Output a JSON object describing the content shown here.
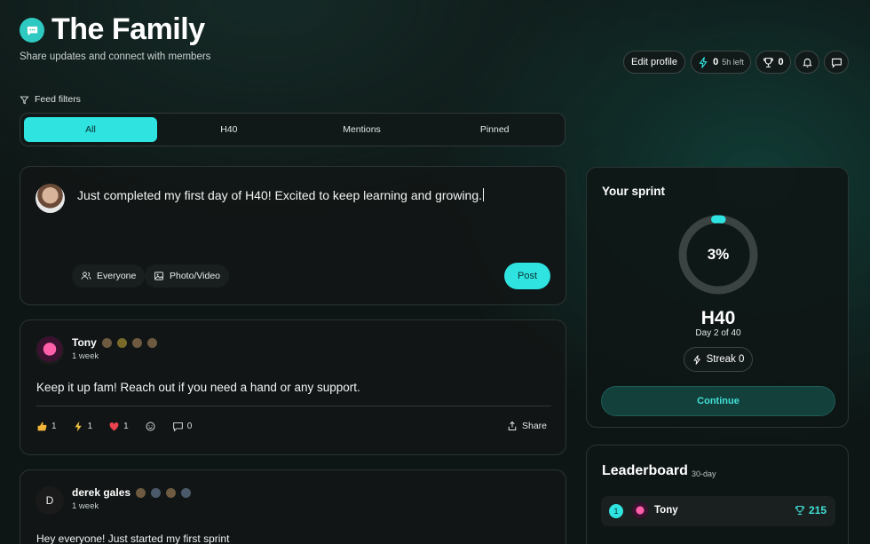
{
  "header": {
    "logo_icon": "chat-bubble-icon",
    "title": "The Family",
    "subtitle": "Share updates and connect with members",
    "edit_profile": "Edit profile",
    "energy_value": "0",
    "energy_left": "5h left",
    "trophy_value": "0"
  },
  "filters": {
    "label": "Feed filters",
    "tabs": [
      "All",
      "H40",
      "Mentions",
      "Pinned"
    ],
    "active": "All"
  },
  "composer": {
    "text": "Just completed my first day of H40! Excited to keep learning and growing.",
    "audience": "Everyone",
    "media": "Photo/Video",
    "post": "Post"
  },
  "posts": [
    {
      "author": "Tony",
      "time": "1 week",
      "body": "Keep it up fam! Reach out if you need a hand or any support.",
      "reactions": [
        {
          "icon": "thumbs-up-icon",
          "count": "1"
        },
        {
          "icon": "bolt-icon",
          "count": "1"
        },
        {
          "icon": "heart-icon",
          "count": "1"
        }
      ],
      "comments": "0",
      "share": "Share"
    },
    {
      "author": "derek gales",
      "initial": "D",
      "time": "1 week",
      "body": "Hey everyone! Just started my first sprint"
    }
  ],
  "sprint": {
    "title": "Your sprint",
    "progress_pct": 3,
    "progress_label": "3%",
    "name": "H40",
    "day": "Day 2 of 40",
    "streak": "Streak 0",
    "continue": "Continue"
  },
  "leaderboard": {
    "title": "Leaderboard",
    "period": "30-day",
    "rows": [
      {
        "rank": "1",
        "name": "Tony",
        "score": "215"
      }
    ]
  },
  "colors": {
    "accent": "#2ee3e0",
    "background": "#0e1615",
    "card": "#111616"
  }
}
